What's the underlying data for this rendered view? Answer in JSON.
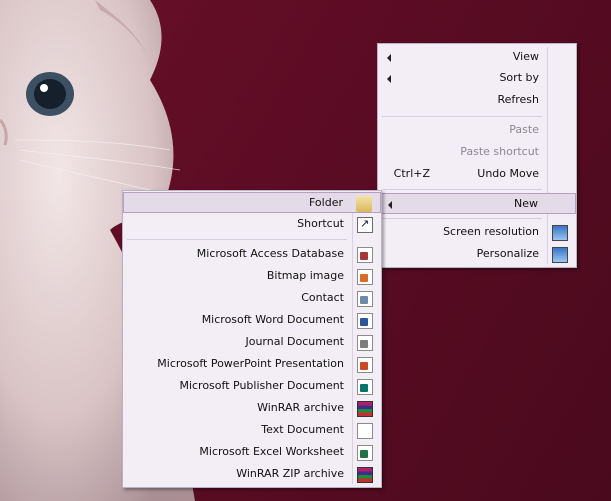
{
  "main_menu": {
    "items": [
      {
        "label": "View",
        "submenu": true
      },
      {
        "label": "Sort by",
        "submenu": true
      },
      {
        "label": "Refresh"
      },
      {
        "label": "Paste",
        "disabled": true
      },
      {
        "label": "Paste shortcut",
        "disabled": true
      },
      {
        "label": "Undo Move",
        "shortcut": "Ctrl+Z"
      },
      {
        "label": "New",
        "submenu": true
      },
      {
        "label": "Screen resolution",
        "icon": "screen-resolution-icon"
      },
      {
        "label": "Personalize",
        "icon": "personalize-icon"
      }
    ]
  },
  "new_submenu": {
    "items": [
      {
        "label": "Folder",
        "icon": "folder-icon"
      },
      {
        "label": "Shortcut",
        "icon": "shortcut-icon"
      },
      {
        "label": "Microsoft Access Database",
        "icon": "access-database-icon"
      },
      {
        "label": "Bitmap image",
        "icon": "bitmap-icon"
      },
      {
        "label": "Contact",
        "icon": "contact-icon"
      },
      {
        "label": "Microsoft Word Document",
        "icon": "word-document-icon"
      },
      {
        "label": "Journal Document",
        "icon": "journal-document-icon"
      },
      {
        "label": "Microsoft PowerPoint Presentation",
        "icon": "powerpoint-icon"
      },
      {
        "label": "Microsoft Publisher Document",
        "icon": "publisher-icon"
      },
      {
        "label": "WinRAR archive",
        "icon": "winrar-icon"
      },
      {
        "label": "Text Document",
        "icon": "text-document-icon"
      },
      {
        "label": "Microsoft Excel Worksheet",
        "icon": "excel-icon"
      },
      {
        "label": "WinRAR ZIP archive",
        "icon": "winrar-zip-icon"
      }
    ]
  },
  "colors": {
    "wallpaper": "#5a0c22",
    "menu_bg": "#f3eef6",
    "highlight": "#e4dbe8"
  }
}
